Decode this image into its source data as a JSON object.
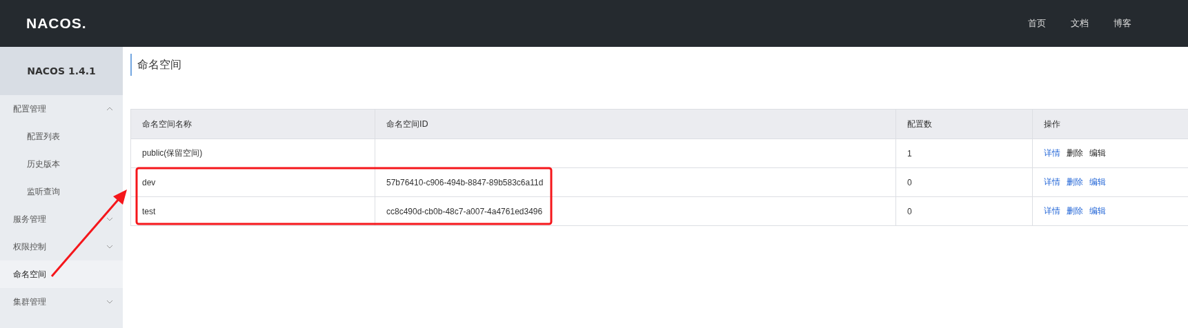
{
  "topbar": {
    "logo": "NACOS.",
    "nav": [
      "首页",
      "文档",
      "博客"
    ]
  },
  "sidebar": {
    "title": "NACOS 1.4.1",
    "items": [
      {
        "label": "配置管理",
        "expanded": true,
        "selected": false,
        "children": [
          {
            "label": "配置列表",
            "selected": false
          },
          {
            "label": "历史版本",
            "selected": false
          },
          {
            "label": "监听查询",
            "selected": false
          }
        ]
      },
      {
        "label": "服务管理",
        "expanded": false,
        "selected": false
      },
      {
        "label": "权限控制",
        "expanded": false,
        "selected": false
      },
      {
        "label": "命名空间",
        "selected": true
      },
      {
        "label": "集群管理",
        "expanded": false,
        "selected": false
      }
    ]
  },
  "page": {
    "title": "命名空间"
  },
  "table": {
    "columns": [
      "命名空间名称",
      "命名空间ID",
      "配置数",
      "操作"
    ],
    "rows": [
      {
        "name": "public(保留空间)",
        "id": "",
        "count": "1",
        "actions": [
          {
            "label": "详情",
            "disabled": false
          },
          {
            "label": "删除",
            "disabled": true
          },
          {
            "label": "编辑",
            "disabled": true
          }
        ]
      },
      {
        "name": "dev",
        "id": "57b76410-c906-494b-8847-89b583c6a11d",
        "count": "0",
        "actions": [
          {
            "label": "详情",
            "disabled": false
          },
          {
            "label": "删除",
            "disabled": false
          },
          {
            "label": "编辑",
            "disabled": false
          }
        ]
      },
      {
        "name": "test",
        "id": "cc8c490d-cb0b-48c7-a007-4a4761ed3496",
        "count": "0",
        "actions": [
          {
            "label": "详情",
            "disabled": false
          },
          {
            "label": "删除",
            "disabled": false
          },
          {
            "label": "编辑",
            "disabled": false
          }
        ]
      }
    ]
  }
}
